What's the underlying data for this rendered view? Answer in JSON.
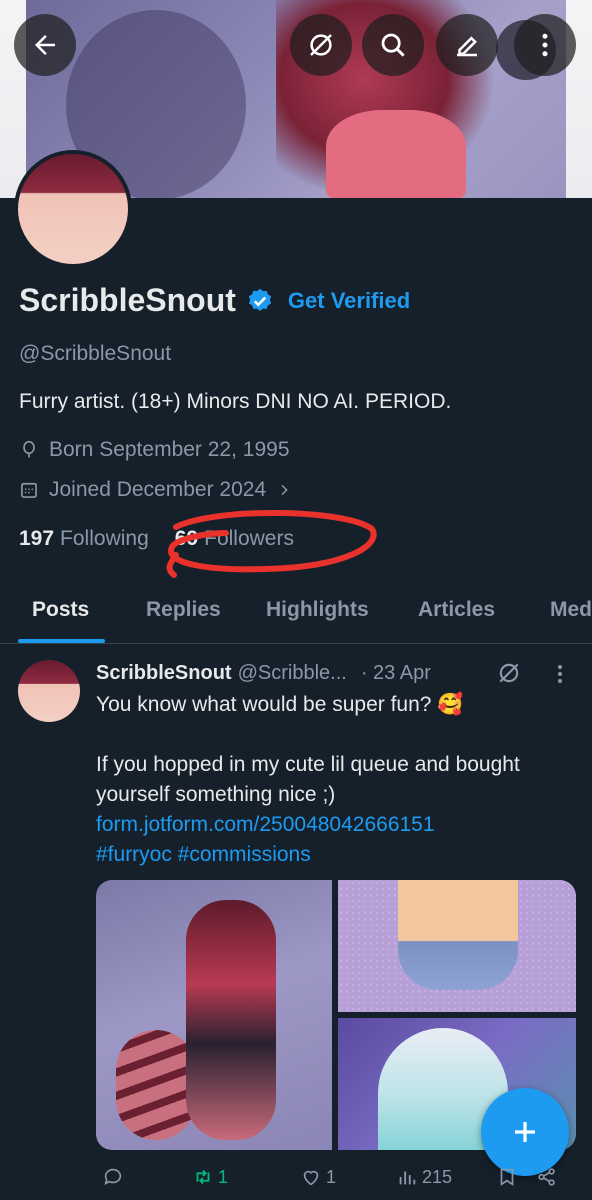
{
  "profile": {
    "name": "ScribbleSnout",
    "get_verified": "Get Verified",
    "handle": "@ScribbleSnout",
    "bio": "Furry artist. (18+) Minors DNI NO AI. PERIOD.",
    "born": "Born September 22, 1995",
    "joined": "Joined December 2024",
    "following_count": "197",
    "following_label": "Following",
    "followers_count": "69",
    "followers_label": "Followers"
  },
  "topbar": {
    "icons": [
      "back-arrow-icon",
      "grok-icon",
      "search-icon",
      "edit-icon",
      "more-vertical-icon"
    ]
  },
  "tabs": [
    {
      "label": "Posts",
      "active": true
    },
    {
      "label": "Replies"
    },
    {
      "label": "Highlights"
    },
    {
      "label": "Articles"
    },
    {
      "label": "Media"
    }
  ],
  "post": {
    "author": "ScribbleSnout",
    "handle": "@Scribble...",
    "date": "· 23 Apr",
    "line1": "You know what would be super fun? 🥰",
    "line2": "If you hopped in my cute lil queue and bought yourself something nice ;)",
    "link": "form.jotform.com/250048042666151",
    "hashtags": "#furryoc #commissions",
    "replies": "",
    "retweets": "1",
    "likes": "1",
    "views": "215"
  },
  "colors": {
    "accent": "#1d9bf0",
    "background": "#15202b",
    "retweet": "#00ba7c",
    "annotation": "#e8322b"
  }
}
